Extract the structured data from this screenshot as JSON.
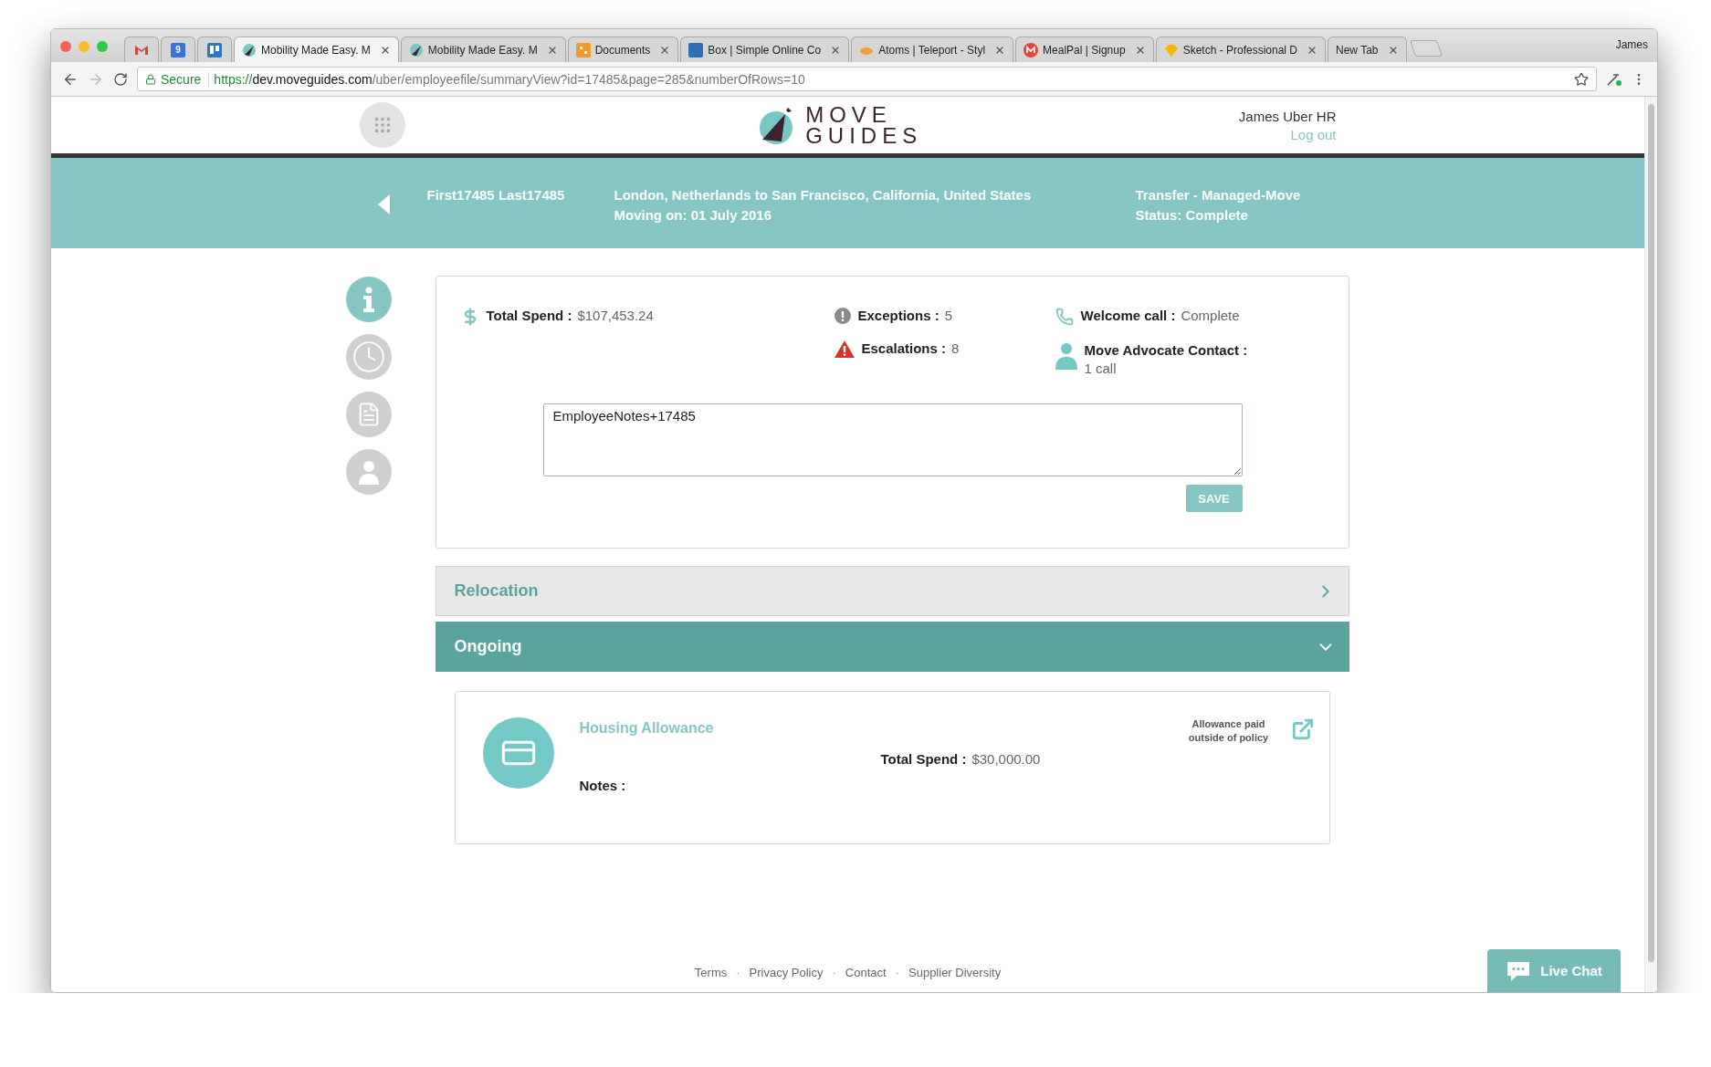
{
  "browser": {
    "tabs": [
      {
        "kind": "mail",
        "selected": false
      },
      {
        "kind": "calendar",
        "label": "9",
        "selected": false
      },
      {
        "kind": "board",
        "selected": false
      },
      {
        "kind": "logo",
        "title": "Mobility Made Easy. M",
        "selected": true
      },
      {
        "kind": "logo",
        "title": "Mobility Made Easy. M",
        "selected": false
      },
      {
        "kind": "grid",
        "title": "Documents",
        "selected": false
      },
      {
        "kind": "box",
        "title": "Box | Simple Online Co",
        "selected": false
      },
      {
        "kind": "cloud",
        "title": "Atoms | Teleport - Styl",
        "selected": false
      },
      {
        "kind": "letter",
        "title": "MealPal | Signup",
        "selected": false
      },
      {
        "kind": "gem",
        "title": "Sketch - Professional D",
        "selected": false
      },
      {
        "kind": "blank",
        "title": "New Tab",
        "selected": false
      }
    ],
    "profile": "James",
    "address": {
      "secure_label": "Secure",
      "scheme": "https://",
      "host": "dev.moveguides.com",
      "path": "/uber/employeefile/summaryView?id=17485&page=285&numberOfRows=10"
    }
  },
  "header": {
    "logo": [
      "MOVE",
      "GUIDES"
    ],
    "user": "James Uber HR",
    "logout": "Log out"
  },
  "banner": {
    "name": "First17485 Last17485",
    "route": "London, Netherlands to San Francisco, California, United States",
    "moving_on": "Moving on: 01 July 2016",
    "move_type": "Transfer - Managed-Move",
    "status": "Status: Complete"
  },
  "side_nav": [
    {
      "kind": "info",
      "selected": true
    },
    {
      "kind": "clock",
      "selected": false
    },
    {
      "kind": "document",
      "selected": false
    },
    {
      "kind": "person",
      "selected": false
    }
  ],
  "summary": {
    "columns": [
      [
        {
          "kind": "dollar",
          "label": "Total Spend :",
          "value": "$107,453.24"
        }
      ],
      [
        {
          "kind": "exception",
          "label": "Exceptions :",
          "value": "5"
        },
        {
          "kind": "warning",
          "label": "Escalations :",
          "value": "8"
        }
      ],
      [
        {
          "kind": "phone",
          "label": "Welcome call :",
          "value": "Complete"
        },
        {
          "kind": "person",
          "label": "Move Advocate Contact :",
          "value": "1 call",
          "stacked": true
        }
      ]
    ],
    "notes": "EmployeeNotes+17485",
    "save": "SAVE"
  },
  "sections": [
    {
      "title": "Relocation",
      "expanded": false
    },
    {
      "title": "Ongoing",
      "expanded": true
    }
  ],
  "allowance": {
    "title": "Housing Allowance",
    "total_label": "Total Spend :",
    "total_value": "$30,000.00",
    "notes_label": "Notes :",
    "flag": "Allowance paid outside of policy"
  },
  "footer": {
    "links": [
      "Terms",
      "Privacy Policy",
      "Contact",
      "Supplier Diversity"
    ],
    "separator": "·"
  },
  "live_chat": "Live Chat"
}
